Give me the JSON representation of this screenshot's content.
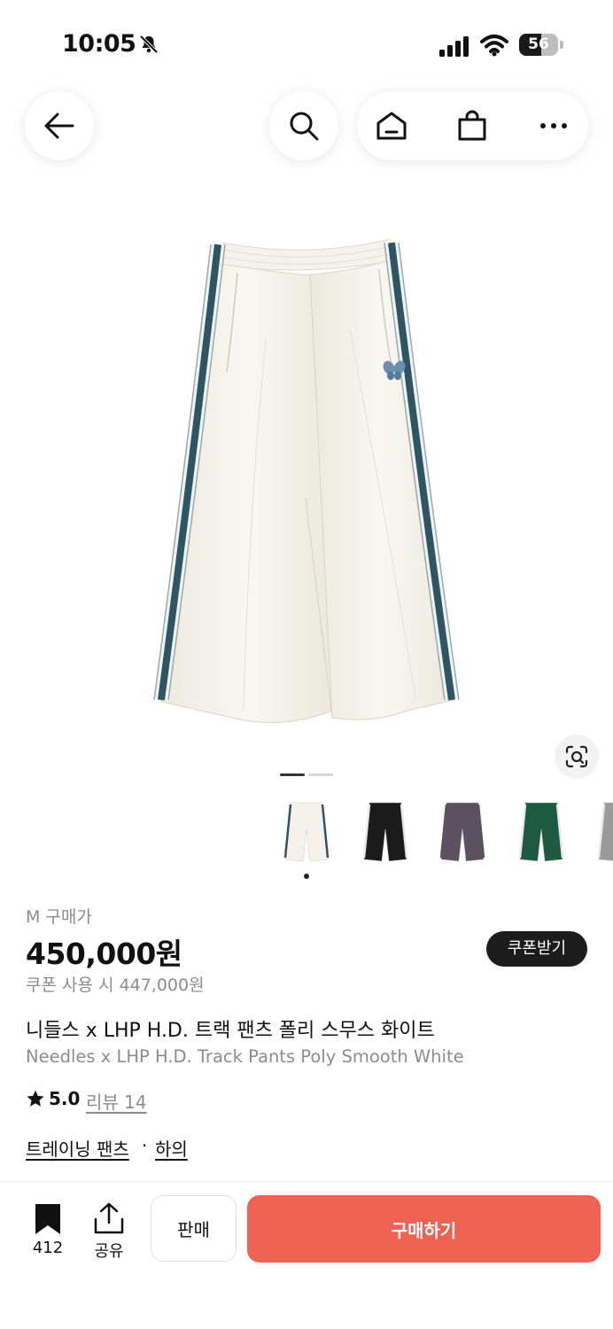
{
  "status_bar": {
    "time": "10:05",
    "battery": "56",
    "battery_level": 0.56
  },
  "header": {
    "icons": [
      "back-arrow-icon",
      "search-icon",
      "home-icon",
      "shopping-bag-icon",
      "more-icon"
    ]
  },
  "gallery": {
    "page_indicator": {
      "count": 2,
      "active": 0
    },
    "color_thumbnails": [
      {
        "name": "white",
        "body": "#f4f2ea",
        "stripe": "#2c5566"
      },
      {
        "name": "black",
        "body": "#1b1b1b",
        "stripe": "#e8e8e8"
      },
      {
        "name": "purple",
        "body": "#5b5160",
        "stripe": "#5b5160"
      },
      {
        "name": "green",
        "body": "#1d5a43",
        "stripe": "#e8e8e8"
      },
      {
        "name": "gray",
        "body": "#9a9a9a",
        "stripe": "#e8e8e8"
      }
    ]
  },
  "product": {
    "size_price_label": "M 구매가",
    "price": "450,000원",
    "coupon_price": "쿠폰 사용 시 447,000원",
    "coupon_button": "쿠폰받기",
    "name_ko": "니들스 x LHP H.D. 트랙 팬츠 폴리 스무스 화이트",
    "name_en": "Needles x LHP H.D. Track Pants Poly Smooth White",
    "rating": "5.0",
    "reviews": "리뷰 14",
    "category": "트레이닝 팬츠",
    "separator": "·",
    "subcategory": "하의"
  },
  "bottom_bar": {
    "bookmark_count": "412",
    "share_label": "공유",
    "sell_label": "판매",
    "buy_label": "구매하기"
  },
  "colors": {
    "accent": "#ef6253",
    "dark": "#1c1c1c",
    "muted": "#8c8c8c",
    "stripe": "#2c5566"
  }
}
